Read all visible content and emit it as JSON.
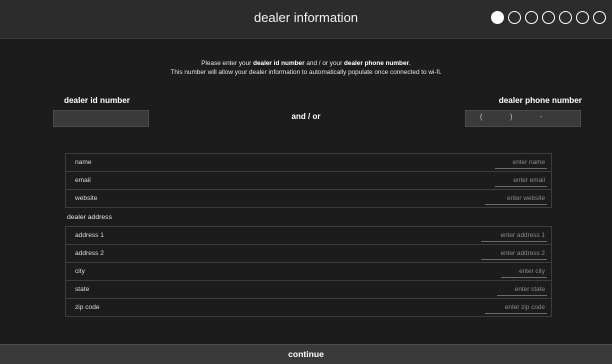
{
  "header": {
    "title": "dealer information",
    "steps_total": 7,
    "steps_active": 1
  },
  "intro": {
    "line1_prefix": "Please enter your ",
    "line1_bold1": "dealer id number",
    "line1_mid": " and / or your ",
    "line1_bold2": "dealer phone number",
    "line1_suffix": ".",
    "line2": "This number will allow your dealer information to automatically populate once connected to wi-fi."
  },
  "dealer_id": {
    "label": "dealer id number",
    "value": ""
  },
  "and_or": "and / or",
  "dealer_phone": {
    "label": "dealer phone number",
    "open_paren": "(",
    "close_paren": ")",
    "dash": "-"
  },
  "contact_fields": [
    {
      "label": "name",
      "placeholder": "enter name"
    },
    {
      "label": "email",
      "placeholder": "enter email"
    },
    {
      "label": "website",
      "placeholder": "enter website"
    }
  ],
  "address_section": {
    "title": "dealer address"
  },
  "address_fields": [
    {
      "label": "address 1",
      "placeholder": "enter address 1"
    },
    {
      "label": "address 2",
      "placeholder": "enter address 2"
    },
    {
      "label": "city",
      "placeholder": "enter city"
    },
    {
      "label": "state",
      "placeholder": "enter state"
    },
    {
      "label": "zip code",
      "placeholder": "enter zip code"
    }
  ],
  "footer": {
    "continue_label": "continue"
  }
}
